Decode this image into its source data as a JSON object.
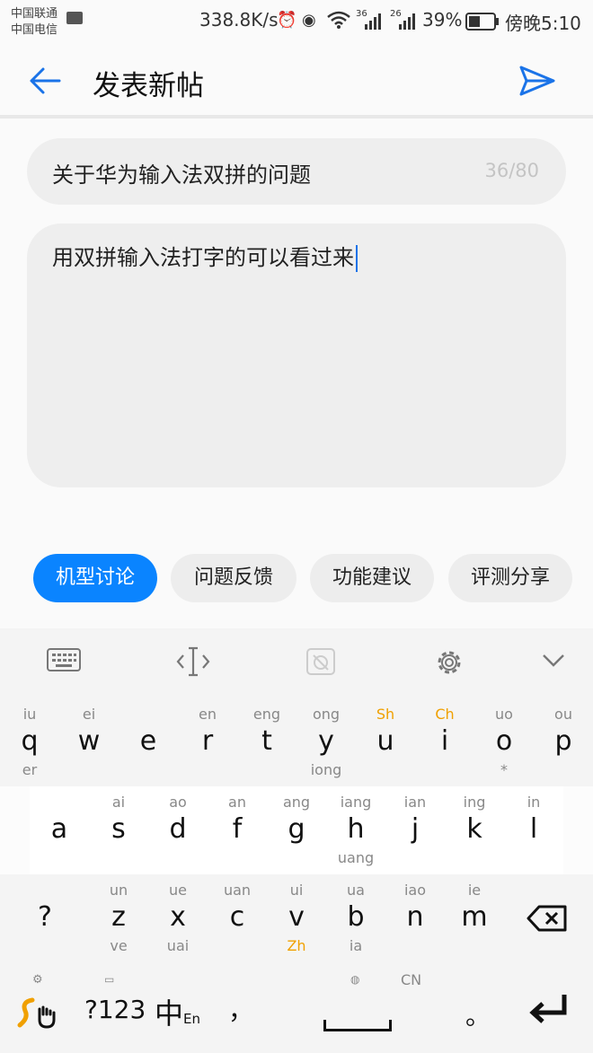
{
  "status_bar": {
    "carrier_1": "中国联通",
    "carrier_2": "中国电信",
    "net_speed": "338.8K/s",
    "signal_1": "36",
    "signal_2": "26",
    "battery_pct": "39%",
    "clock": "傍晚5:10",
    "icons": [
      "keyboard-indicator-icon",
      "alarm-icon",
      "eye-icon",
      "wifi-icon",
      "signal-icon",
      "battery-icon"
    ]
  },
  "header": {
    "title": "发表新帖",
    "icons": [
      "back-arrow-icon",
      "send-icon"
    ],
    "accent_color": "#1a73e8"
  },
  "form": {
    "title_value": "关于华为输入法双拼的问题",
    "title_count": "36/80",
    "body_value": "用双拼输入法打字的可以看过来"
  },
  "categories": [
    {
      "label": "机型讨论",
      "active": true
    },
    {
      "label": "问题反馈",
      "active": false
    },
    {
      "label": "功能建议",
      "active": false
    },
    {
      "label": "评测分享",
      "active": false
    }
  ],
  "keyboard": {
    "toolbar_icons": [
      "keyboard-icon",
      "cursor-icon",
      "clipboard-icon",
      "settings-icon",
      "collapse-icon"
    ],
    "row1": [
      {
        "main": "q",
        "top": "iu",
        "bottom": "er"
      },
      {
        "main": "w",
        "top": "ei",
        "bottom": ""
      },
      {
        "main": "e",
        "top": "",
        "bottom": ""
      },
      {
        "main": "r",
        "top": "en",
        "bottom": ""
      },
      {
        "main": "t",
        "top": "eng",
        "bottom": ""
      },
      {
        "main": "y",
        "top": "ong",
        "bottom": "iong"
      },
      {
        "main": "u",
        "top": "Sh",
        "bottom": "",
        "top_highlight": true
      },
      {
        "main": "i",
        "top": "Ch",
        "bottom": "",
        "top_highlight": true
      },
      {
        "main": "o",
        "top": "uo",
        "bottom": "*"
      },
      {
        "main": "p",
        "top": "ou",
        "bottom": ""
      }
    ],
    "row2": [
      {
        "main": "a",
        "top": "",
        "bottom": ""
      },
      {
        "main": "s",
        "top": "ai",
        "bottom": ""
      },
      {
        "main": "d",
        "top": "ao",
        "bottom": ""
      },
      {
        "main": "f",
        "top": "an",
        "bottom": ""
      },
      {
        "main": "g",
        "top": "ang",
        "bottom": ""
      },
      {
        "main": "h",
        "top": "iang",
        "bottom": "uang"
      },
      {
        "main": "j",
        "top": "ian",
        "bottom": ""
      },
      {
        "main": "k",
        "top": "ing",
        "bottom": ""
      },
      {
        "main": "l",
        "top": "in",
        "bottom": ""
      }
    ],
    "row3_symbol": "?",
    "row3": [
      {
        "main": "z",
        "top": "un",
        "bottom": "ve"
      },
      {
        "main": "x",
        "top": "ue",
        "bottom": "uai"
      },
      {
        "main": "c",
        "top": "uan",
        "bottom": ""
      },
      {
        "main": "v",
        "top": "ui",
        "bottom": "Zh",
        "bottom_highlight": true
      },
      {
        "main": "b",
        "top": "ua",
        "bottom": "ia"
      },
      {
        "main": "n",
        "top": "iao",
        "bottom": ""
      },
      {
        "main": "m",
        "top": "ie",
        "bottom": ""
      }
    ],
    "row4": {
      "num_label": "?123",
      "lang_main": "中",
      "lang_sub": "En",
      "comma": "，",
      "cn_label": "CN",
      "period": "。",
      "icons": [
        "swype-icon",
        "backspace-icon",
        "enter-icon",
        "globe-icon"
      ]
    },
    "highlight_color": "#f0a000"
  }
}
